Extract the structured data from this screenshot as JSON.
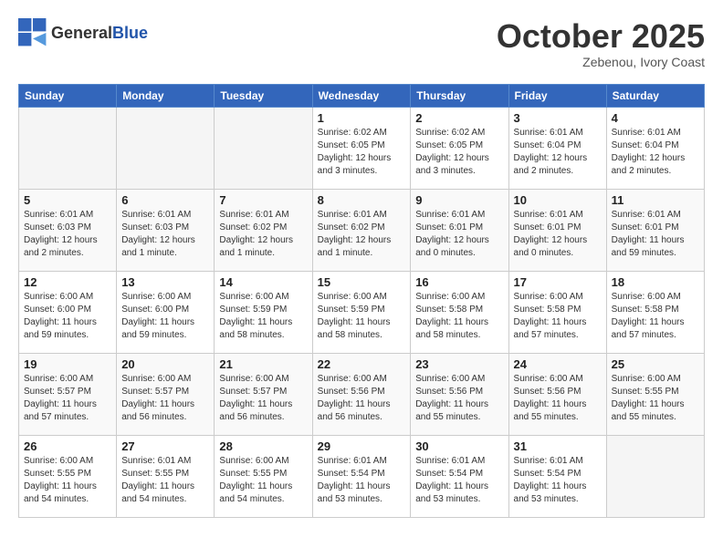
{
  "header": {
    "logo_general": "General",
    "logo_blue": "Blue",
    "month_title": "October 2025",
    "subtitle": "Zebenou, Ivory Coast"
  },
  "days_of_week": [
    "Sunday",
    "Monday",
    "Tuesday",
    "Wednesday",
    "Thursday",
    "Friday",
    "Saturday"
  ],
  "weeks": [
    [
      {
        "num": "",
        "info": ""
      },
      {
        "num": "",
        "info": ""
      },
      {
        "num": "",
        "info": ""
      },
      {
        "num": "1",
        "info": "Sunrise: 6:02 AM\nSunset: 6:05 PM\nDaylight: 12 hours and 3 minutes."
      },
      {
        "num": "2",
        "info": "Sunrise: 6:02 AM\nSunset: 6:05 PM\nDaylight: 12 hours and 3 minutes."
      },
      {
        "num": "3",
        "info": "Sunrise: 6:01 AM\nSunset: 6:04 PM\nDaylight: 12 hours and 2 minutes."
      },
      {
        "num": "4",
        "info": "Sunrise: 6:01 AM\nSunset: 6:04 PM\nDaylight: 12 hours and 2 minutes."
      }
    ],
    [
      {
        "num": "5",
        "info": "Sunrise: 6:01 AM\nSunset: 6:03 PM\nDaylight: 12 hours and 2 minutes."
      },
      {
        "num": "6",
        "info": "Sunrise: 6:01 AM\nSunset: 6:03 PM\nDaylight: 12 hours and 1 minute."
      },
      {
        "num": "7",
        "info": "Sunrise: 6:01 AM\nSunset: 6:02 PM\nDaylight: 12 hours and 1 minute."
      },
      {
        "num": "8",
        "info": "Sunrise: 6:01 AM\nSunset: 6:02 PM\nDaylight: 12 hours and 1 minute."
      },
      {
        "num": "9",
        "info": "Sunrise: 6:01 AM\nSunset: 6:01 PM\nDaylight: 12 hours and 0 minutes."
      },
      {
        "num": "10",
        "info": "Sunrise: 6:01 AM\nSunset: 6:01 PM\nDaylight: 12 hours and 0 minutes."
      },
      {
        "num": "11",
        "info": "Sunrise: 6:01 AM\nSunset: 6:01 PM\nDaylight: 11 hours and 59 minutes."
      }
    ],
    [
      {
        "num": "12",
        "info": "Sunrise: 6:00 AM\nSunset: 6:00 PM\nDaylight: 11 hours and 59 minutes."
      },
      {
        "num": "13",
        "info": "Sunrise: 6:00 AM\nSunset: 6:00 PM\nDaylight: 11 hours and 59 minutes."
      },
      {
        "num": "14",
        "info": "Sunrise: 6:00 AM\nSunset: 5:59 PM\nDaylight: 11 hours and 58 minutes."
      },
      {
        "num": "15",
        "info": "Sunrise: 6:00 AM\nSunset: 5:59 PM\nDaylight: 11 hours and 58 minutes."
      },
      {
        "num": "16",
        "info": "Sunrise: 6:00 AM\nSunset: 5:58 PM\nDaylight: 11 hours and 58 minutes."
      },
      {
        "num": "17",
        "info": "Sunrise: 6:00 AM\nSunset: 5:58 PM\nDaylight: 11 hours and 57 minutes."
      },
      {
        "num": "18",
        "info": "Sunrise: 6:00 AM\nSunset: 5:58 PM\nDaylight: 11 hours and 57 minutes."
      }
    ],
    [
      {
        "num": "19",
        "info": "Sunrise: 6:00 AM\nSunset: 5:57 PM\nDaylight: 11 hours and 57 minutes."
      },
      {
        "num": "20",
        "info": "Sunrise: 6:00 AM\nSunset: 5:57 PM\nDaylight: 11 hours and 56 minutes."
      },
      {
        "num": "21",
        "info": "Sunrise: 6:00 AM\nSunset: 5:57 PM\nDaylight: 11 hours and 56 minutes."
      },
      {
        "num": "22",
        "info": "Sunrise: 6:00 AM\nSunset: 5:56 PM\nDaylight: 11 hours and 56 minutes."
      },
      {
        "num": "23",
        "info": "Sunrise: 6:00 AM\nSunset: 5:56 PM\nDaylight: 11 hours and 55 minutes."
      },
      {
        "num": "24",
        "info": "Sunrise: 6:00 AM\nSunset: 5:56 PM\nDaylight: 11 hours and 55 minutes."
      },
      {
        "num": "25",
        "info": "Sunrise: 6:00 AM\nSunset: 5:55 PM\nDaylight: 11 hours and 55 minutes."
      }
    ],
    [
      {
        "num": "26",
        "info": "Sunrise: 6:00 AM\nSunset: 5:55 PM\nDaylight: 11 hours and 54 minutes."
      },
      {
        "num": "27",
        "info": "Sunrise: 6:01 AM\nSunset: 5:55 PM\nDaylight: 11 hours and 54 minutes."
      },
      {
        "num": "28",
        "info": "Sunrise: 6:00 AM\nSunset: 5:55 PM\nDaylight: 11 hours and 54 minutes."
      },
      {
        "num": "29",
        "info": "Sunrise: 6:01 AM\nSunset: 5:54 PM\nDaylight: 11 hours and 53 minutes."
      },
      {
        "num": "30",
        "info": "Sunrise: 6:01 AM\nSunset: 5:54 PM\nDaylight: 11 hours and 53 minutes."
      },
      {
        "num": "31",
        "info": "Sunrise: 6:01 AM\nSunset: 5:54 PM\nDaylight: 11 hours and 53 minutes."
      },
      {
        "num": "",
        "info": ""
      }
    ]
  ]
}
